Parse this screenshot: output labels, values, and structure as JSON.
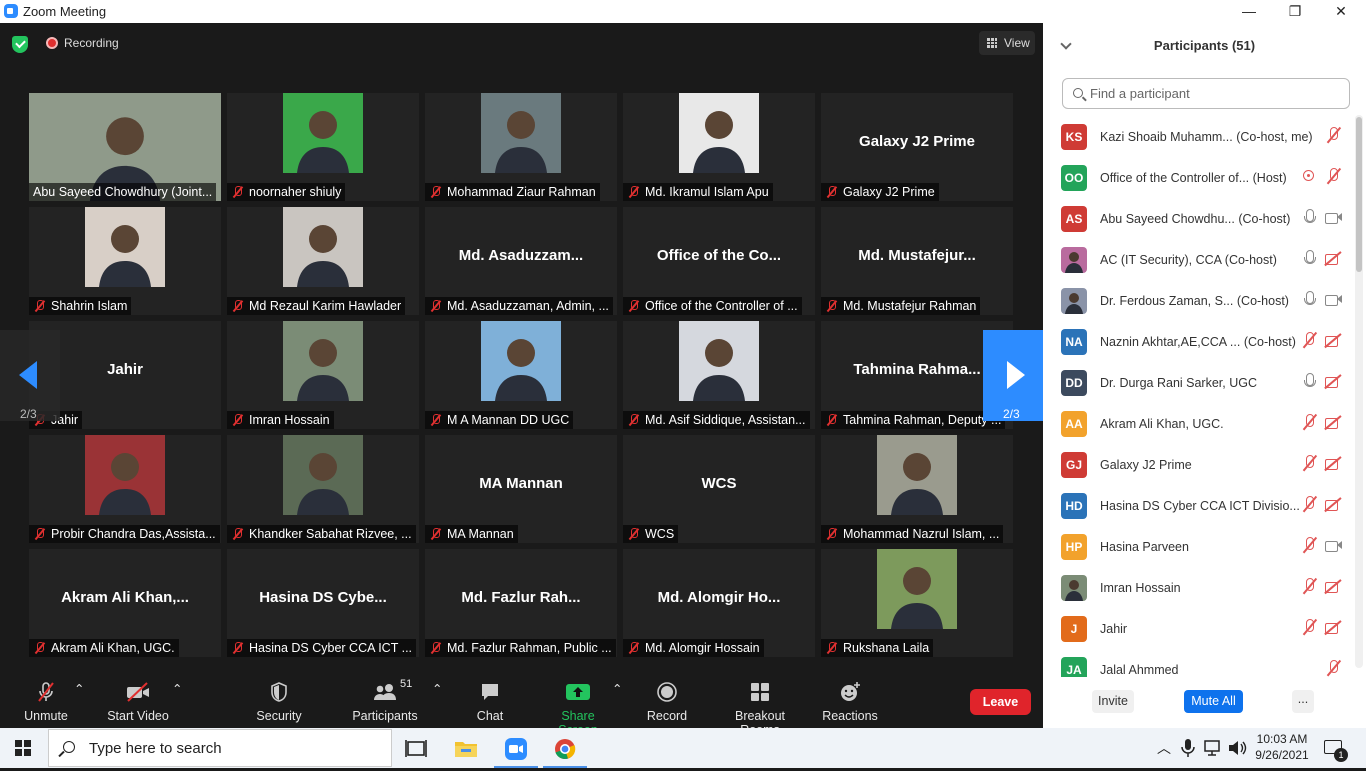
{
  "window": {
    "title": "Zoom Meeting",
    "minimize": "—",
    "restore": "❐",
    "close": "✕"
  },
  "meeting": {
    "recording": "Recording",
    "view": "View",
    "page_prev": "2/3",
    "page_next": "2/3"
  },
  "tiles": [
    {
      "label": "Abu Sayeed Chowdhury (Joint...",
      "muted": false,
      "photo": "wide",
      "bg": "#8f9a8a"
    },
    {
      "label": "noornaher shiuly",
      "muted": true,
      "photo": "person",
      "bg": "#3aa84a"
    },
    {
      "label": "Mohammad Ziaur Rahman",
      "muted": true,
      "photo": "person",
      "bg": "#6a7a7e"
    },
    {
      "label": "Md. Ikramul Islam Apu",
      "muted": true,
      "photo": "person",
      "bg": "#e8e8e8"
    },
    {
      "label": "Galaxy J2 Prime",
      "muted": true,
      "big": "Galaxy J2 Prime"
    },
    {
      "label": "Shahrin Islam",
      "muted": true,
      "photo": "person",
      "bg": "#d8cfc7"
    },
    {
      "label": "Md Rezaul Karim Hawlader",
      "muted": true,
      "photo": "person",
      "bg": "#c9c5c0"
    },
    {
      "label": "Md. Asaduzzaman, Admin, ...",
      "muted": true,
      "big": "Md.  Asaduzzam..."
    },
    {
      "label": "Office of the Controller of ...",
      "muted": true,
      "big": "Office  of  the  Co..."
    },
    {
      "label": "Md. Mustafejur Rahman",
      "muted": true,
      "big": "Md.  Mustafejur..."
    },
    {
      "label": "Jahir",
      "muted": true,
      "big": "Jahir"
    },
    {
      "label": "Imran Hossain",
      "muted": true,
      "photo": "person",
      "bg": "#7b8c76"
    },
    {
      "label": "M A Mannan DD UGC",
      "muted": true,
      "photo": "person",
      "bg": "#7fb0d8"
    },
    {
      "label": "Md. Asif Siddique, Assistan...",
      "muted": true,
      "photo": "person",
      "bg": "#d5d8de"
    },
    {
      "label": "Tahmina Rahman, Deputy ...",
      "muted": true,
      "big": "Tahmina  Rahma..."
    },
    {
      "label": "Probir Chandra Das,Assista...",
      "muted": true,
      "photo": "person",
      "bg": "#9a3336"
    },
    {
      "label": "Khandker Sabahat Rizvee, ...",
      "muted": true,
      "photo": "person",
      "bg": "#5b6a55"
    },
    {
      "label": "MA Mannan",
      "muted": true,
      "big": "MA Mannan"
    },
    {
      "label": "WCS",
      "muted": true,
      "big": "WCS"
    },
    {
      "label": "Mohammad Nazrul Islam, ...",
      "muted": true,
      "photo": "person",
      "bg": "#9a9b8e"
    },
    {
      "label": "Akram Ali Khan, UGC.",
      "muted": true,
      "big": "Akram  Ali  Khan,..."
    },
    {
      "label": "Hasina DS Cyber CCA ICT ...",
      "muted": true,
      "big": "Hasina  DS  Cybe..."
    },
    {
      "label": "Md. Fazlur Rahman, Public ...",
      "muted": true,
      "big": "Md.  Fazlur  Rah..."
    },
    {
      "label": "Md. Alomgir Hossain",
      "muted": true,
      "big": "Md.  Alomgir  Ho..."
    },
    {
      "label": "Rukshana Laila",
      "muted": true,
      "photo": "person",
      "bg": "#7d9a5c"
    }
  ],
  "toolbar": {
    "unmute": "Unmute",
    "start_video": "Start Video",
    "security": "Security",
    "participants": "Participants",
    "participants_count": "51",
    "chat": "Chat",
    "share_screen": "Share Screen",
    "record": "Record",
    "breakout_rooms": "Breakout Rooms",
    "reactions": "Reactions",
    "leave": "Leave"
  },
  "panel": {
    "title": "Participants (51)",
    "search_placeholder": "Find a participant",
    "invite": "Invite",
    "mute_all": "Mute All",
    "more": "...",
    "participants": [
      {
        "initials": "KS",
        "color": "#cf3b35",
        "name": "Kazi Shoaib Muhamm...",
        "role": "(Co-host, me)",
        "mic": "off",
        "cam": "none",
        "rec": false
      },
      {
        "initials": "OO",
        "color": "#23a45a",
        "name": "Office of the Controller of...",
        "role": "(Host)",
        "mic": "off",
        "cam": "none",
        "rec": true
      },
      {
        "initials": "AS",
        "color": "#cf3b35",
        "name": "Abu Sayeed Chowdhu...",
        "role": "(Co-host)",
        "mic": "on",
        "cam": "on",
        "rec": false
      },
      {
        "initials": "",
        "color": "#b96b9e",
        "name": "AC (IT Security), CCA (Co-host)",
        "role": "",
        "mic": "on",
        "cam": "off",
        "rec": false,
        "photo": true
      },
      {
        "initials": "",
        "color": "#8a93a8",
        "name": "Dr. Ferdous Zaman, S...",
        "role": "(Co-host)",
        "mic": "on",
        "cam": "on",
        "rec": false,
        "photo": true
      },
      {
        "initials": "NA",
        "color": "#2b73b8",
        "name": "Naznin Akhtar,AE,CCA ...",
        "role": "(Co-host)",
        "mic": "off",
        "cam": "off",
        "rec": false
      },
      {
        "initials": "DD",
        "color": "#3c4a5e",
        "name": "Dr. Durga Rani Sarker, UGC",
        "role": "",
        "mic": "on",
        "cam": "off",
        "rec": false
      },
      {
        "initials": "AA",
        "color": "#f2a22c",
        "name": "Akram Ali Khan, UGC.",
        "role": "",
        "mic": "off",
        "cam": "off",
        "rec": false
      },
      {
        "initials": "GJ",
        "color": "#cf3b35",
        "name": "Galaxy J2 Prime",
        "role": "",
        "mic": "off",
        "cam": "off",
        "rec": false
      },
      {
        "initials": "HD",
        "color": "#2b73b8",
        "name": "Hasina DS Cyber CCA ICT Divisio...",
        "role": "",
        "mic": "off",
        "cam": "off",
        "rec": false
      },
      {
        "initials": "HP",
        "color": "#f2a22c",
        "name": "Hasina Parveen",
        "role": "",
        "mic": "off",
        "cam": "on",
        "rec": false
      },
      {
        "initials": "",
        "color": "#7b8c76",
        "name": "Imran Hossain",
        "role": "",
        "mic": "off",
        "cam": "off",
        "rec": false,
        "photo": true
      },
      {
        "initials": "J",
        "color": "#e26b1b",
        "name": "Jahir",
        "role": "",
        "mic": "off",
        "cam": "off",
        "rec": false
      },
      {
        "initials": "JA",
        "color": "#23a45a",
        "name": "Jalal Ahmmed",
        "role": "",
        "mic": "off",
        "cam": "none",
        "rec": false
      }
    ]
  },
  "taskbar": {
    "search_placeholder": "Type here to search",
    "time": "10:03 AM",
    "date": "9/26/2021",
    "notifications": "1"
  }
}
